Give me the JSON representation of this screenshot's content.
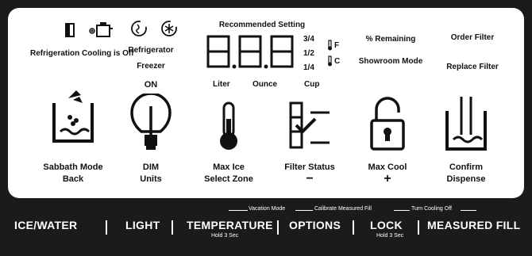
{
  "status": {
    "refrigeration_cooling_off": "Refrigeration Cooling is Off",
    "refrigerator": "Refrigerator",
    "freezer": "Freezer",
    "on": "ON",
    "recommended_setting": "Recommended Setting",
    "display_value": "8.8.8",
    "fraction_3_4": "3/4",
    "fraction_1_2": "1/2",
    "fraction_1_4": "1/4",
    "unit_f": "F",
    "unit_c": "C",
    "liter": "Liter",
    "ounce": "Ounce",
    "cup": "Cup",
    "percent_remaining": "% Remaining",
    "showroom_mode": "Showroom Mode",
    "order_filter": "Order Filter",
    "replace_filter": "Replace Filter"
  },
  "icon_labels": {
    "sabbath_back": [
      "Sabbath Mode",
      "Back"
    ],
    "dim_units": [
      "DIM",
      "Units"
    ],
    "max_ice_zone": [
      "Max  Ice",
      "Select Zone"
    ],
    "filter_status": [
      "Filter Status",
      "−"
    ],
    "max_cool": [
      "Max Cool",
      "+"
    ],
    "confirm_dispense": [
      "Confirm",
      "Dispense"
    ]
  },
  "hold_labels": {
    "vacation_mode": "Vacation Mode",
    "calibrate_fill": "Calibrate Measured Fill",
    "turn_cooling_off": "Turn Cooling Off"
  },
  "buttons": {
    "ice_water": "ICE/WATER",
    "light": "LIGHT",
    "temperature": "TEMPERATURE",
    "temperature_sub": "Hold 3 Sec",
    "options": "OPTIONS",
    "lock": "LOCK",
    "lock_sub": "Hold 3 Sec",
    "measured_fill": "MEASURED FILL"
  }
}
